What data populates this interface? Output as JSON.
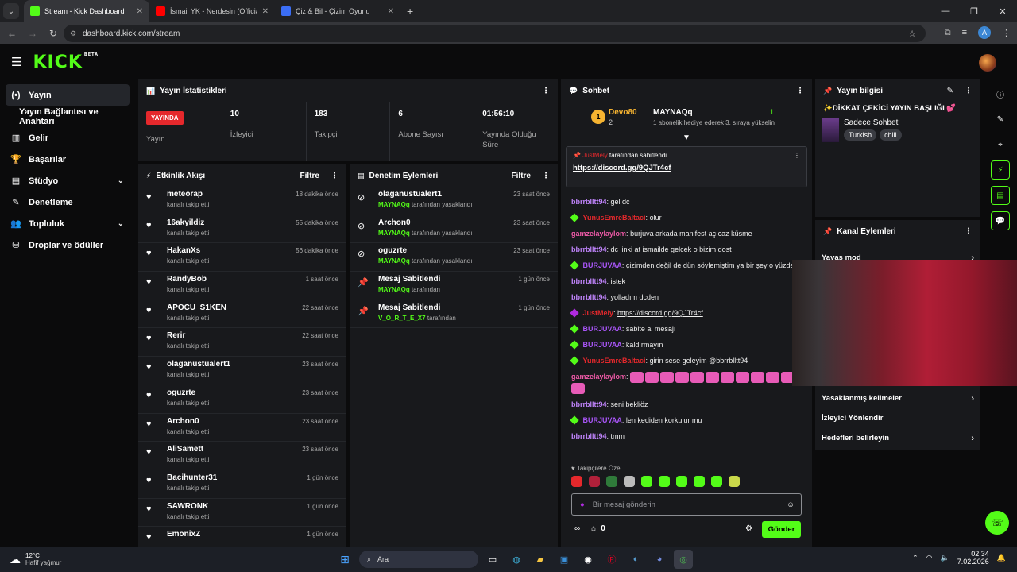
{
  "browser": {
    "tabs": [
      {
        "label": "Stream - Kick Dashboard",
        "color": "#53fc18",
        "active": true
      },
      {
        "label": "İsmail YK - Nerdesin (Official Vi",
        "color": "#ff0000",
        "active": false
      },
      {
        "label": "Çiz & Bil - Çizim Oyunu",
        "color": "#3b6ef5",
        "active": false
      }
    ],
    "url": "dashboard.kick.com/stream",
    "profile_initial": "A"
  },
  "app": {
    "logo": "KICK",
    "beta": "BETA"
  },
  "sidebar": {
    "items": [
      {
        "label": "Yayın",
        "icon": "(•)"
      },
      {
        "label": "Yayın Bağlantısı ve Anahtarı",
        "icon": ""
      },
      {
        "label": "Gelir",
        "icon": "▥"
      },
      {
        "label": "Başarılar",
        "icon": "🏆"
      },
      {
        "label": "Stüdyo",
        "icon": "▤"
      },
      {
        "label": "Denetleme",
        "icon": "✎"
      },
      {
        "label": "Topluluk",
        "icon": "👥"
      },
      {
        "label": "Droplar ve ödüller",
        "icon": "⛁"
      }
    ]
  },
  "stats": {
    "title": "Yayın İstatistikleri",
    "live_badge": "YAYINDA",
    "live_label": "Yayın",
    "items": [
      {
        "value": "10",
        "label": "İzleyici"
      },
      {
        "value": "183",
        "label": "Takipçi"
      },
      {
        "value": "6",
        "label": "Abone Sayısı"
      },
      {
        "value": "01:56:10",
        "label": "Yayında Olduğu Süre"
      }
    ]
  },
  "activity": {
    "title": "Etkinlik Akışı",
    "filter": "Filtre",
    "items": [
      {
        "name": "meteorap",
        "sub": "kanalı takip etti",
        "time": "18 dakika önce"
      },
      {
        "name": "16akyildiz",
        "sub": "kanalı takip etti",
        "time": "55 dakika önce"
      },
      {
        "name": "HakanXs",
        "sub": "kanalı takip etti",
        "time": "56 dakika önce"
      },
      {
        "name": "RandyBob",
        "sub": "kanalı takip etti",
        "time": "1 saat önce"
      },
      {
        "name": "APOCU_S1KEN",
        "sub": "kanalı takip etti",
        "time": "22 saat önce"
      },
      {
        "name": "Rerir",
        "sub": "kanalı takip etti",
        "time": "22 saat önce"
      },
      {
        "name": "olaganustualert1",
        "sub": "kanalı takip etti",
        "time": "23 saat önce"
      },
      {
        "name": "oguzrte",
        "sub": "kanalı takip etti",
        "time": "23 saat önce"
      },
      {
        "name": "Archon0",
        "sub": "kanalı takip etti",
        "time": "23 saat önce"
      },
      {
        "name": "AliSamett",
        "sub": "kanalı takip etti",
        "time": "23 saat önce"
      },
      {
        "name": "Bacihunter31",
        "sub": "kanalı takip etti",
        "time": "1 gün önce"
      },
      {
        "name": "SAWRONK",
        "sub": "kanalı takip etti",
        "time": "1 gün önce"
      },
      {
        "name": "EmonixZ",
        "sub": "",
        "time": "1 gün önce"
      }
    ]
  },
  "moderation": {
    "title": "Denetim Eylemleri",
    "filter": "Filtre",
    "items": [
      {
        "name": "olaganustualert1",
        "actor": "MAYNAQq",
        "action": "tarafından yasaklandı",
        "time": "23 saat önce",
        "icon": "⊘"
      },
      {
        "name": "Archon0",
        "actor": "MAYNAQq",
        "action": "tarafından yasaklandı",
        "time": "23 saat önce",
        "icon": "⊘"
      },
      {
        "name": "oguzrte",
        "actor": "MAYNAQq",
        "action": "tarafından yasaklandı",
        "time": "23 saat önce",
        "icon": "⊘"
      },
      {
        "name": "Mesaj Sabitlendi",
        "actor": "MAYNAQq",
        "action": "tarafından",
        "time": "1 gün önce",
        "icon": "📌"
      },
      {
        "name": "Mesaj Sabitlendi",
        "actor": "V_O_R_T_E_X7",
        "action": "tarafından",
        "time": "1 gün önce",
        "icon": "📌"
      }
    ]
  },
  "chat": {
    "title": "Sohbet",
    "top": {
      "rank": "1",
      "user1": "Devo80",
      "count1": "2",
      "user2": "MAYNAQq",
      "count2": "1",
      "gift_note": "1 abonelik hediye ederek 3. sıraya yükselin"
    },
    "pinned": {
      "by_user": "JustMely",
      "by_text": "tarafından sabitlendi",
      "link": "https://discord.gg/9QJTr4cf"
    },
    "messages": [
      {
        "user": "bbrrblltt94",
        "color": "#c084fc",
        "badge": "",
        "text": "gel dc"
      },
      {
        "user": "YunusEmreBaltaci",
        "color": "#e5282c",
        "badge": "#53fc18",
        "text": "olur"
      },
      {
        "user": "gamzelaylaylom",
        "color": "#f05aa8",
        "badge": "",
        "text": "burjuva arkada manifest açıcaz küsme"
      },
      {
        "user": "bbrrblltt94",
        "color": "#c084fc",
        "badge": "",
        "text": "dc linki at ismailde gelcek o bizim dost"
      },
      {
        "user": "BURJUVAA",
        "color": "#a855f7",
        "badge": "#53fc18",
        "text": "çizimden değil de dün söylemiştim ya bir şey o yüzden"
      },
      {
        "user": "bbrrblltt94",
        "color": "#c084fc",
        "badge": "",
        "text": "istek"
      },
      {
        "user": "bbrrblltt94",
        "color": "#c084fc",
        "badge": "",
        "text": "yolladım dcden"
      },
      {
        "user": "JustMely",
        "color": "#e5282c",
        "badge": "#b02ae0",
        "text": "https://discord.gg/9QJTr4cf"
      },
      {
        "user": "BURJUVAA",
        "color": "#a855f7",
        "badge": "#53fc18",
        "text": "sabite al mesajı"
      },
      {
        "user": "BURJUVAA",
        "color": "#a855f7",
        "badge": "#53fc18",
        "text": "kaldırmayın"
      },
      {
        "user": "YunusEmreBaltaci",
        "color": "#e5282c",
        "badge": "#53fc18",
        "text": "girin sese geleyim @bbrrblltt94"
      },
      {
        "user": "gamzelaylaylom",
        "color": "#f05aa8",
        "badge": "",
        "text": "",
        "emotes": 12
      },
      {
        "user": "bbrrblltt94",
        "color": "#c084fc",
        "badge": "",
        "text": "seni bekliöz"
      },
      {
        "user": "BURJUVAA",
        "color": "#a855f7",
        "badge": "#53fc18",
        "text": "len kediden korkulur mu"
      },
      {
        "user": "bbrrblltt94",
        "color": "#c084fc",
        "badge": "",
        "text": "tmm"
      }
    ],
    "followers_only": "Takipçilere Özel",
    "input_placeholder": "Bir mesaj gönderin",
    "points": "0",
    "send": "Gönder"
  },
  "stream_info": {
    "title": "Yayın bilgisi",
    "stream_title": "✨DİKKAT ÇEKİCİ YAYIN BAŞLIĞI 💕",
    "category": "Sadece Sohbet",
    "tags": [
      "Turkish",
      "chill"
    ]
  },
  "channel_actions": {
    "title": "Kanal Eylemleri",
    "items": [
      {
        "label": "Yavaş mod",
        "chevron": true
      },
      {
        "label": "Yasaklanmış kelimeler",
        "chevron": true
      },
      {
        "label": "İzleyici Yönlendir",
        "chevron": false
      },
      {
        "label": "Hedefleri belirleyin",
        "chevron": true
      }
    ]
  },
  "taskbar": {
    "weather_temp": "12°C",
    "weather_desc": "Hafif yağmur",
    "search": "Ara",
    "time": "02:34",
    "date": "7.02.2026"
  }
}
